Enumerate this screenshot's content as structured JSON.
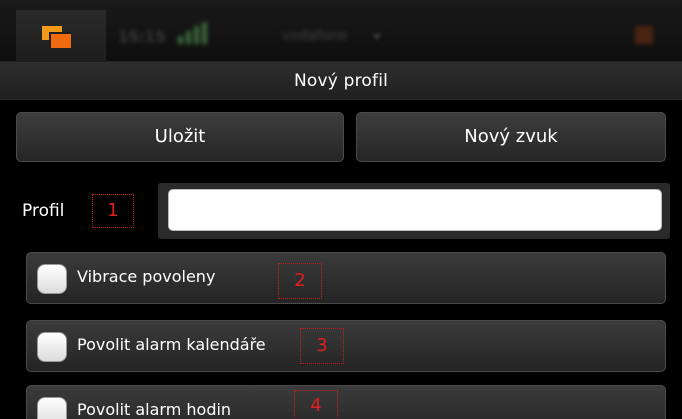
{
  "statusbar": {
    "time": "15:15",
    "operator": "vodafone",
    "icons": [
      "tasks-icon",
      "signal-icon",
      "status-menu-icon",
      "close-icon"
    ],
    "accent": "#f39a1a"
  },
  "titlebar": {
    "title": "Nový profil"
  },
  "toolbar": {
    "save_label": "Uložit",
    "new_sound_label": "Nový zvuk"
  },
  "profile": {
    "label": "Profil",
    "value": ""
  },
  "options": [
    {
      "label": "Vibrace povoleny",
      "checked": false
    },
    {
      "label": "Povolit alarm kalendáře",
      "checked": false
    },
    {
      "label": "Povolit alarm hodin",
      "checked": false
    }
  ],
  "markers": [
    "1",
    "2",
    "3",
    "4"
  ],
  "colors": {
    "marker": "#e01f1f",
    "background": "#000000"
  }
}
